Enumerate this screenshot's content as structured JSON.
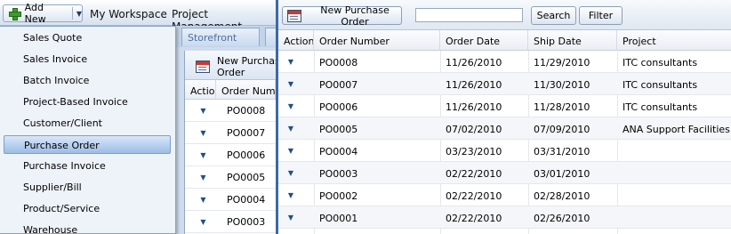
{
  "topbar": {
    "add_new_label": "Add New",
    "nav": [
      "My Workspace",
      "Project Management"
    ]
  },
  "tabs": {
    "storefront": "Storefront"
  },
  "add_new_menu": {
    "items": [
      "Sales Quote",
      "Sales Invoice",
      "Batch Invoice",
      "Project-Based Invoice",
      "Customer/Client",
      "Purchase Order",
      "Purchase Invoice",
      "Supplier/Bill",
      "Product/Service",
      "Warehouse"
    ],
    "active": "Purchase Order"
  },
  "inner_panel": {
    "new_button_label": "New Purchase Order",
    "columns": [
      "Action",
      "Order Number"
    ],
    "orders": [
      "PO0008",
      "PO0007",
      "PO0006",
      "PO0005",
      "PO0004",
      "PO0003"
    ]
  },
  "main": {
    "toolbar": {
      "new_button_label": "New Purchase Order",
      "search_value": "",
      "search_button": "Search",
      "filter_button": "Filter"
    },
    "columns": [
      "Action",
      "Order Number",
      "Order Date",
      "Ship Date",
      "Project"
    ],
    "rows": [
      {
        "order": "PO0008",
        "order_date": "11/26/2010",
        "ship_date": "11/29/2010",
        "project": "ITC consultants"
      },
      {
        "order": "PO0007",
        "order_date": "11/26/2010",
        "ship_date": "11/30/2010",
        "project": "ITC consultants"
      },
      {
        "order": "PO0006",
        "order_date": "11/26/2010",
        "ship_date": "11/28/2010",
        "project": "ITC consultants"
      },
      {
        "order": "PO0005",
        "order_date": "07/02/2010",
        "ship_date": "07/09/2010",
        "project": "ANA Support Facilities in K"
      },
      {
        "order": "PO0004",
        "order_date": "03/23/2010",
        "ship_date": "03/31/2010",
        "project": ""
      },
      {
        "order": "PO0003",
        "order_date": "02/22/2010",
        "ship_date": "03/01/2010",
        "project": ""
      },
      {
        "order": "PO0002",
        "order_date": "02/22/2010",
        "ship_date": "02/28/2010",
        "project": ""
      },
      {
        "order": "PO0001",
        "order_date": "02/22/2010",
        "ship_date": "02/26/2010",
        "project": ""
      }
    ],
    "row_action_icon": "dropdown-arrow-icon"
  },
  "colors": {
    "accent_border": "#3c6aa4",
    "menu_active": "#9cbde6",
    "action_arrow": "#1f4e8c",
    "add_icon": "#3c9c2c"
  }
}
